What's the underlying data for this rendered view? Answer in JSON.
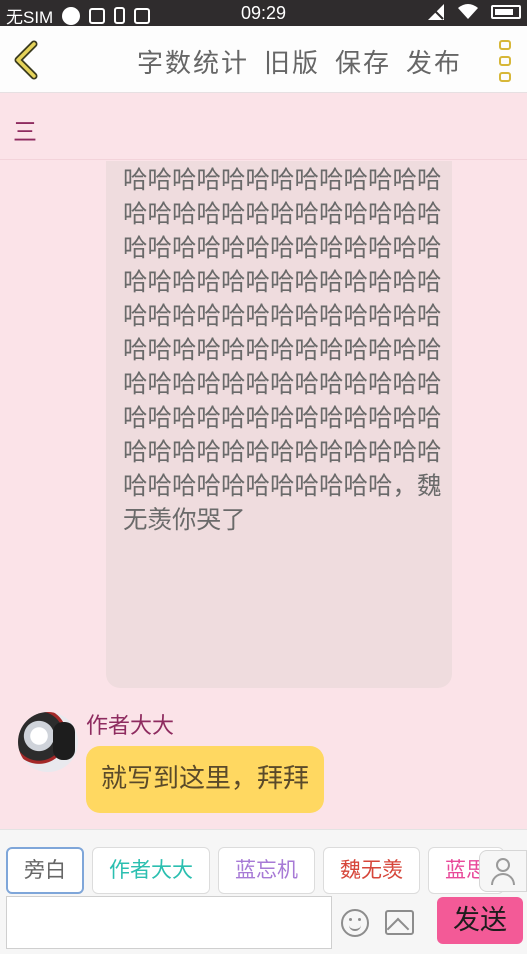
{
  "status_bar": {
    "carrier": "无SIM",
    "time": "09:29"
  },
  "header": {
    "actions": [
      "字数统计",
      "旧版",
      "保存",
      "发布"
    ]
  },
  "subbar": {
    "menu_label": "三"
  },
  "messages": {
    "long_text": "哈哈哈哈哈哈哈哈哈哈哈哈哈哈哈哈哈哈哈哈哈哈哈哈哈哈哈哈哈哈哈哈哈哈哈哈哈哈哈哈哈哈哈哈哈哈哈哈哈哈哈哈哈哈哈哈哈哈哈哈哈哈哈哈哈哈哈哈哈哈哈哈哈哈哈哈哈哈哈哈哈哈哈哈哈哈哈哈哈哈哈哈哈哈哈哈哈哈哈哈哈哈哈哈哈哈哈哈哈哈哈哈哈哈哈哈哈哈哈哈哈哈哈哈哈哈哈哈，魏无羡你哭了",
    "author_name": "作者大大",
    "author_text": "就写到这里，拜拜"
  },
  "characters": [
    {
      "name": "旁白",
      "color": "#666666"
    },
    {
      "name": "作者大大",
      "color": "#2bbfb0"
    },
    {
      "name": "蓝忘机",
      "color": "#a77ad6"
    },
    {
      "name": "魏无羡",
      "color": "#d6463a"
    },
    {
      "name": "蓝思",
      "color": "#e84a9a"
    }
  ],
  "input": {
    "value": "",
    "placeholder": ""
  },
  "send_label": "发送",
  "icons": {
    "back": "back-chevron-icon",
    "more": "more-vertical-icon",
    "person": "person-icon",
    "emoji": "emoji-icon",
    "image": "image-icon"
  }
}
